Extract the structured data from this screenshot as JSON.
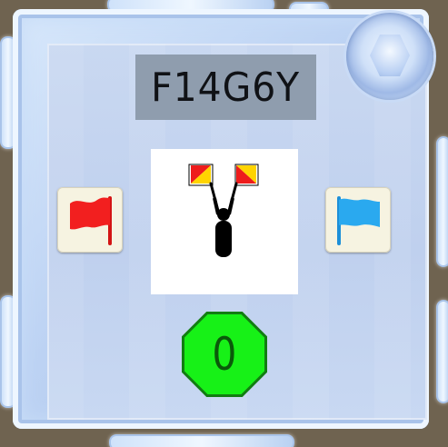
{
  "puzzle": {
    "code": "F14G6Y"
  },
  "signal_card": {
    "icon": "semaphore-signaller-icon",
    "flag_colors": {
      "red": "#ee1c1c",
      "yellow": "#ffd400"
    }
  },
  "buttons": {
    "left": {
      "icon": "red-flag-icon",
      "color": "#f21f1f"
    },
    "right": {
      "icon": "blue-flag-icon",
      "color": "#2aa9ef"
    }
  },
  "score": {
    "value": "0",
    "colors": {
      "fill": "#17f117",
      "border": "#127d12",
      "text": "#0a5a0a"
    }
  }
}
